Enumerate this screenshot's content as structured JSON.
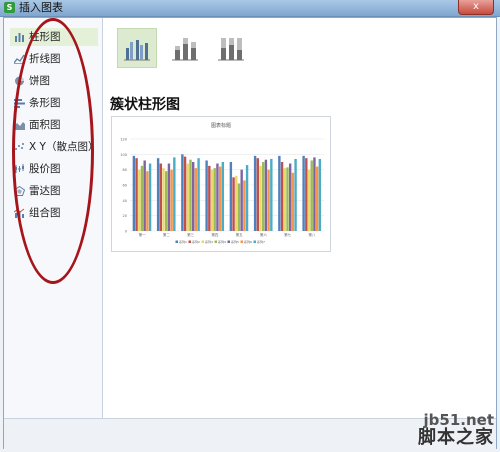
{
  "window": {
    "title": "插入图表",
    "close_label": "x"
  },
  "sidebar": {
    "items": [
      {
        "label": "柱形图",
        "icon": "column-chart-icon",
        "selected": true
      },
      {
        "label": "折线图",
        "icon": "line-chart-icon"
      },
      {
        "label": "饼图",
        "icon": "pie-chart-icon"
      },
      {
        "label": "条形图",
        "icon": "bar-chart-icon"
      },
      {
        "label": "面积图",
        "icon": "area-chart-icon"
      },
      {
        "label": "X Y（散点图）",
        "icon": "scatter-chart-icon"
      },
      {
        "label": "股价图",
        "icon": "stock-chart-icon"
      },
      {
        "label": "雷达图",
        "icon": "radar-chart-icon"
      },
      {
        "label": "组合图",
        "icon": "combo-chart-icon"
      }
    ]
  },
  "subtypes": [
    {
      "name": "簇状柱形图",
      "icon": "clustered-column-icon",
      "selected": true
    },
    {
      "name": "堆积柱形图",
      "icon": "stacked-column-icon"
    },
    {
      "name": "百分比堆积柱形图",
      "icon": "percent-stacked-column-icon"
    }
  ],
  "preview": {
    "heading": "簇状柱形图"
  },
  "chart_data": {
    "type": "bar",
    "title": "图表标题",
    "yticks": [
      "120",
      "100",
      "80",
      "60",
      "40",
      "20",
      "0"
    ],
    "ylim": [
      0,
      120
    ],
    "categories": [
      "第一",
      "第二",
      "第三",
      "第四",
      "第五",
      "第六",
      "第七",
      "第八"
    ],
    "series": [
      {
        "name": "系列1",
        "color": "#4f81bd",
        "values": [
          98,
          95,
          100,
          92,
          90,
          98,
          98,
          98
        ]
      },
      {
        "name": "系列2",
        "color": "#c0504d",
        "values": [
          95,
          88,
          97,
          85,
          70,
          95,
          90,
          95
        ]
      },
      {
        "name": "系列3",
        "color": "#e8d96a",
        "values": [
          80,
          82,
          88,
          80,
          72,
          85,
          82,
          80
        ]
      },
      {
        "name": "系列4",
        "color": "#9bbb59",
        "values": [
          85,
          78,
          93,
          82,
          62,
          90,
          83,
          92
        ]
      },
      {
        "name": "系列5",
        "color": "#8064a2",
        "values": [
          92,
          88,
          90,
          88,
          80,
          93,
          88,
          96
        ]
      },
      {
        "name": "系列6",
        "color": "#f79646",
        "values": [
          78,
          80,
          82,
          84,
          66,
          80,
          76,
          84
        ]
      },
      {
        "name": "系列7",
        "color": "#4bacc6",
        "values": [
          88,
          96,
          95,
          90,
          86,
          94,
          94,
          94
        ]
      }
    ],
    "grid": true,
    "legend": "bottom"
  },
  "watermark": {
    "line1": "jb51.net",
    "line2": "脚本之家"
  }
}
